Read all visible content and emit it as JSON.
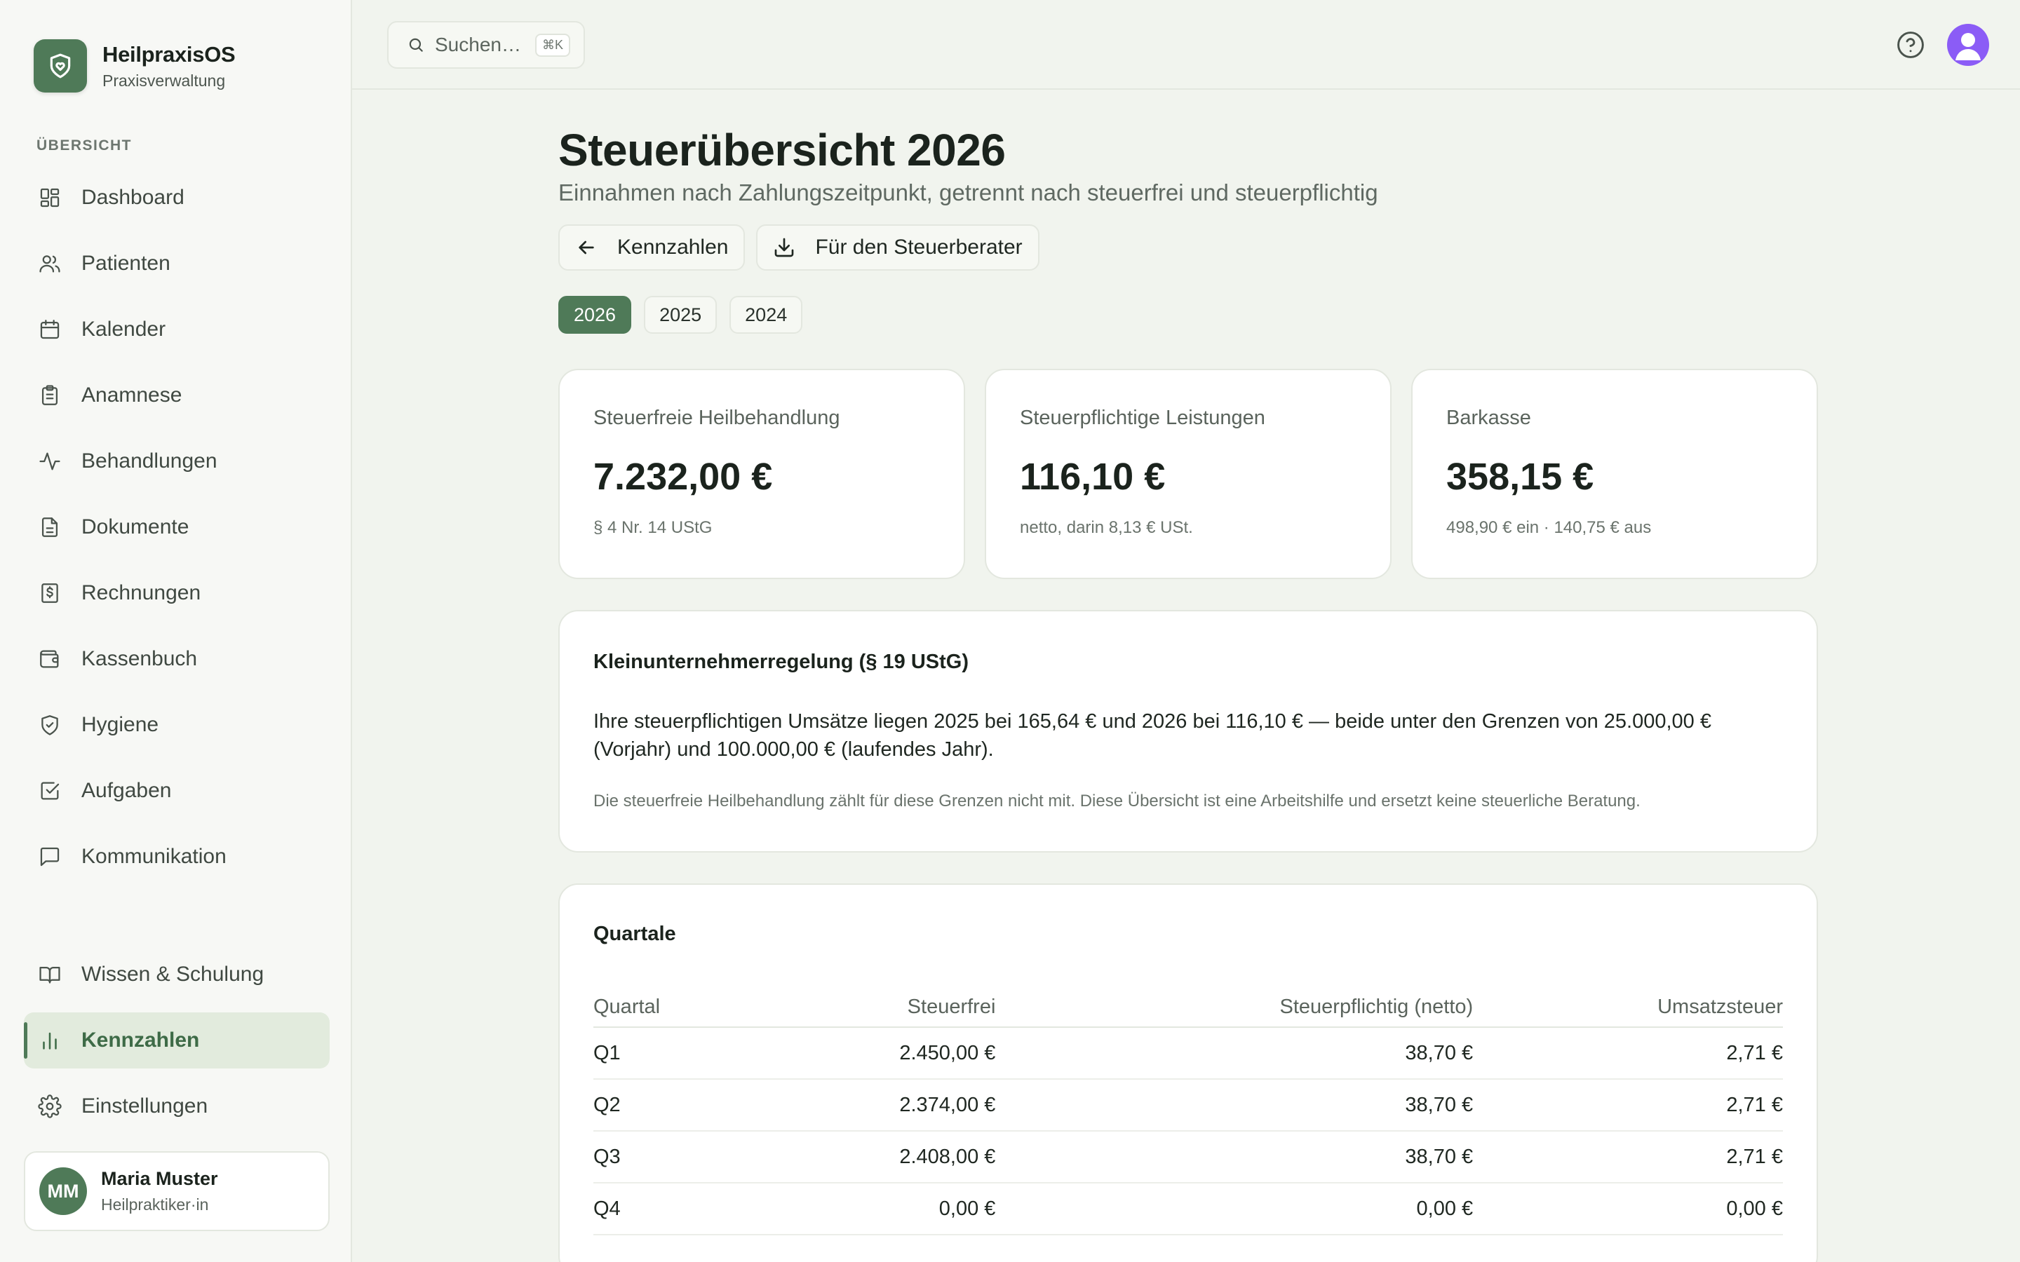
{
  "brand": {
    "name": "HeilpraxisOS",
    "subtitle": "Praxisverwaltung"
  },
  "sidebar": {
    "section_label": "ÜBERSICHT",
    "items": [
      {
        "label": "Dashboard",
        "icon": "grid-icon"
      },
      {
        "label": "Patienten",
        "icon": "users-icon"
      },
      {
        "label": "Kalender",
        "icon": "calendar-icon"
      },
      {
        "label": "Anamnese",
        "icon": "clipboard-icon"
      },
      {
        "label": "Behandlungen",
        "icon": "activity-icon"
      },
      {
        "label": "Dokumente",
        "icon": "document-icon"
      },
      {
        "label": "Rechnungen",
        "icon": "invoice-icon"
      },
      {
        "label": "Kassenbuch",
        "icon": "wallet-icon"
      },
      {
        "label": "Hygiene",
        "icon": "shield-check-icon"
      },
      {
        "label": "Aufgaben",
        "icon": "checkbox-icon"
      },
      {
        "label": "Kommunikation",
        "icon": "chat-icon"
      }
    ],
    "bottom_items": [
      {
        "label": "Wissen & Schulung",
        "icon": "book-icon"
      },
      {
        "label": "Kennzahlen",
        "icon": "bar-chart-icon",
        "active": true
      },
      {
        "label": "Einstellungen",
        "icon": "gear-icon"
      }
    ],
    "user": {
      "initials": "MM",
      "name": "Maria Muster",
      "role": "Heilpraktiker·in"
    }
  },
  "topbar": {
    "search_placeholder": "Suchen…",
    "shortcut": "⌘K"
  },
  "page": {
    "title": "Steuerübersicht 2026",
    "subtitle": "Einnahmen nach Zahlungszeitpunkt, getrennt nach steuerfrei und steuerpflichtig",
    "actions": {
      "back_label": "Kennzahlen",
      "export_label": "Für den Steuerberater"
    },
    "years": [
      "2026",
      "2025",
      "2024"
    ],
    "active_year": "2026"
  },
  "kpis": [
    {
      "label": "Steuerfreie Heilbehandlung",
      "value": "7.232,00 €",
      "note": "§ 4 Nr. 14 UStG"
    },
    {
      "label": "Steuerpflichtige Leistungen",
      "value": "116,10 €",
      "note": "netto, darin 8,13 € USt."
    },
    {
      "label": "Barkasse",
      "value": "358,15 €",
      "note": "498,90 € ein · 140,75 € aus"
    }
  ],
  "small_business": {
    "title": "Kleinunternehmerregelung (§ 19 UStG)",
    "body": "Ihre steuerpflichtigen Umsätze liegen 2025 bei 165,64 € und 2026 bei 116,10 € — beide unter den Grenzen von 25.000,00 € (Vorjahr) und 100.000,00 € (laufendes Jahr).",
    "footnote": "Die steuerfreie Heilbehandlung zählt für diese Grenzen nicht mit. Diese Übersicht ist eine Arbeitshilfe und ersetzt keine steuerliche Beratung."
  },
  "quarters": {
    "title": "Quartale",
    "columns": [
      "Quartal",
      "Steuerfrei",
      "Steuerpflichtig (netto)",
      "Umsatzsteuer"
    ],
    "rows": [
      [
        "Q1",
        "2.450,00 €",
        "38,70 €",
        "2,71 €"
      ],
      [
        "Q2",
        "2.374,00 €",
        "38,70 €",
        "2,71 €"
      ],
      [
        "Q3",
        "2.408,00 €",
        "38,70 €",
        "2,71 €"
      ],
      [
        "Q4",
        "0,00 €",
        "0,00 €",
        "0,00 €"
      ]
    ]
  },
  "colors": {
    "accent": "#4f7a58",
    "avatar": "#8b5cf6",
    "background": "#f1f4ee"
  }
}
